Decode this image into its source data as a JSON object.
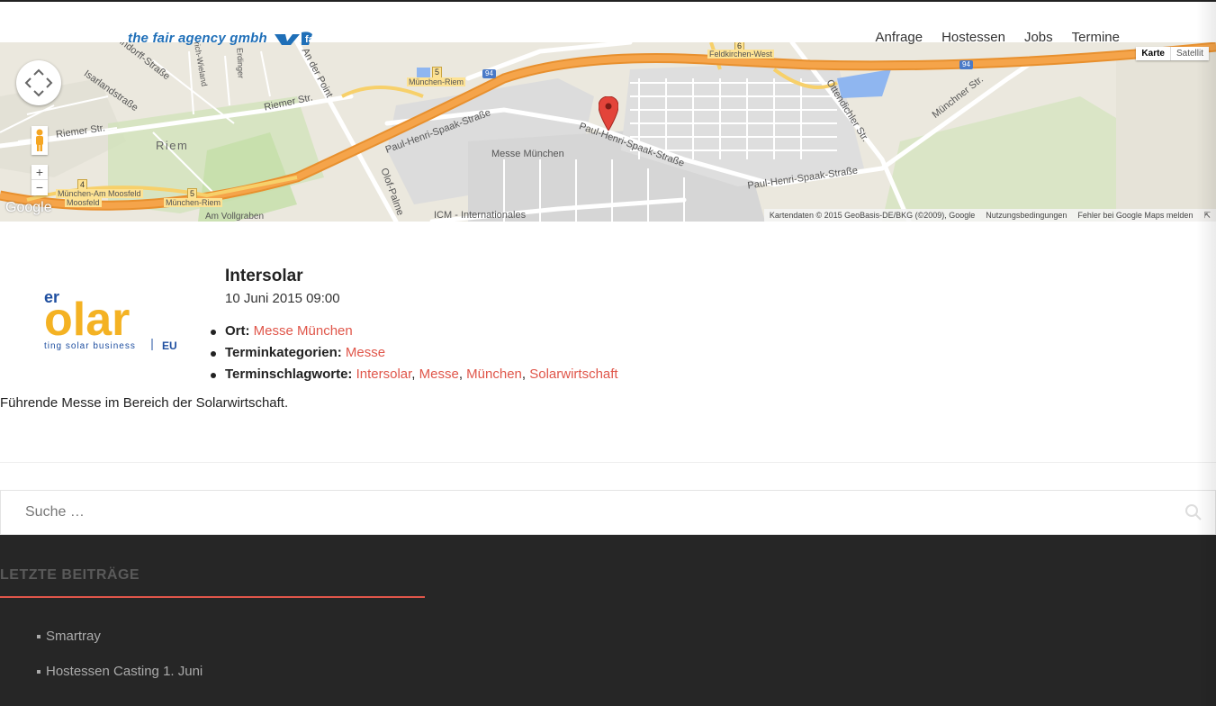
{
  "header": {
    "logo_text": "the fair agency gmbh",
    "nav": [
      "Anfrage",
      "Hostessen",
      "Jobs",
      "Termine"
    ]
  },
  "map": {
    "type_buttons": [
      "Karte",
      "Satellit"
    ],
    "google_logo": "Google",
    "attribution": [
      "Kartendaten © 2015 GeoBasis-DE/BKG (©2009), Google",
      "Nutzungsbedingungen",
      "Fehler bei Google Maps melden"
    ],
    "labels": {
      "lehndorff": "Lehndorff-Straße",
      "isarland": "Isarlandstraße",
      "riemer1": "Riemer Str.",
      "riemer2": "Riemer Str.",
      "riem": "Riem",
      "paulspaak1": "Paul-Henri-Spaak-Straße",
      "paulspaak2": "Paul-Henri-Spaak-Straße",
      "paulspaak3": "Paul-Henri-Spaak-Straße",
      "messe": "Messe München",
      "icm": "ICM - Internationales",
      "olof": "Olof-Palme",
      "ander": "An der Point",
      "ottendichler": "Ottendichler Str.",
      "muenchner": "Münchner Str.",
      "heinrich": "Heinrich-Wieland",
      "erdinger": "Erdinger",
      "kirchen": "Feldkirchen-West",
      "muenchenriem1": "München-Riem",
      "muenchenriem2": "München-Riem",
      "muenchenam": "München-Am Moosfeld",
      "moosfeld": "Moosfeld",
      "vollgraben": "Am Vollgraben"
    },
    "shields": {
      "s5a": "5",
      "s6": "6",
      "s4": "4",
      "s5b": "5",
      "a94a": "94",
      "a94b": "94"
    }
  },
  "event": {
    "title": "Intersolar",
    "date": "10 Juni 2015 09:00",
    "image_text_1": "er",
    "image_text_2": "olar",
    "image_text_3": "ting solar business",
    "image_text_4": "EU",
    "ort_label": "Ort:",
    "ort_value": "Messe München",
    "kat_label": "Terminkategorien:",
    "kat_value": "Messe",
    "tags_label": "Terminschlagworte:",
    "tags": [
      "Intersolar",
      "Messe",
      "München",
      "Solarwirtschaft"
    ],
    "description": "Führende Messe im Bereich der Solarwirtschaft."
  },
  "search": {
    "placeholder": "Suche …"
  },
  "footer": {
    "heading": "LETZTE BEITRÄGE",
    "posts": [
      "Smartray",
      "Hostessen Casting 1. Juni"
    ]
  },
  "colors": {
    "accent": "#e0564a",
    "footer_bg": "#262626",
    "logo_blue": "#1f6fb8",
    "highway": "#f39c3a"
  }
}
